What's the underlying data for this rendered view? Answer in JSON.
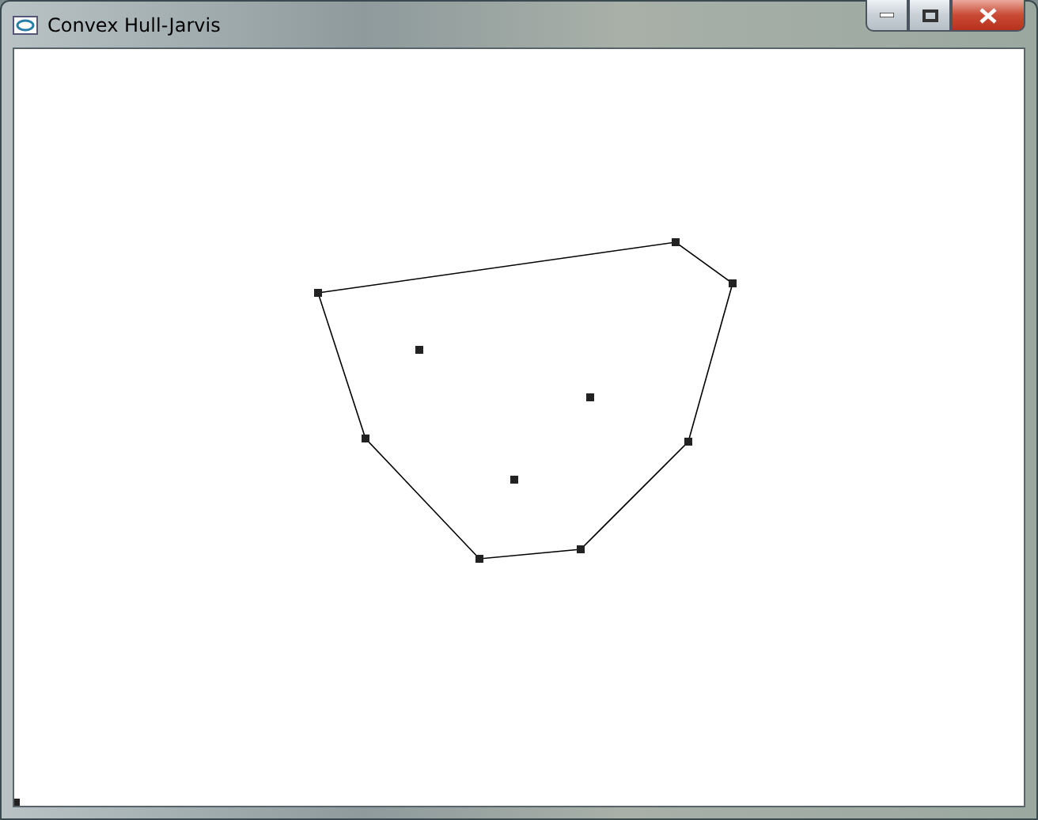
{
  "window": {
    "title": "Convex Hull-Jarvis"
  }
}
